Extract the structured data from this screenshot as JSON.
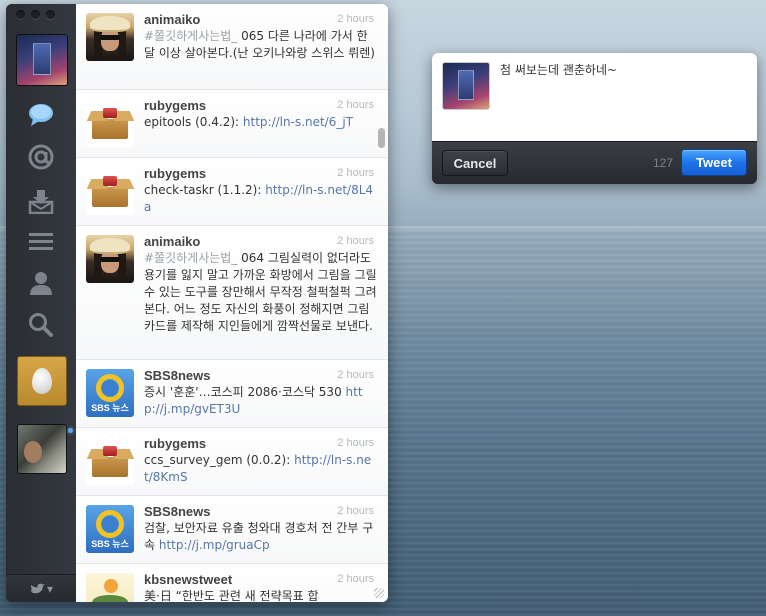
{
  "app": {
    "sidebar": {
      "nav_icons": [
        "timeline-icon",
        "mentions-icon",
        "messages-icon",
        "lists-icon",
        "profile-icon",
        "search-icon"
      ],
      "bottom_icon": "bird-icon",
      "bottom_caret": "▾"
    },
    "compose": {
      "text": "첨 써보는데 괜춘하네~",
      "cancel_label": "Cancel",
      "tweet_label": "Tweet",
      "char_count": "127"
    },
    "timeline": {
      "tweets": [
        {
          "user": "animaiko",
          "time": "2 hours",
          "hashtag": "#쫄깃하게사는법_",
          "text": " 065 다른 나라에 가서 한달 이상 살아본다.(난 오키나와랑 스위스 뤼렌)",
          "link": "",
          "avatar": "animaiko"
        },
        {
          "user": "rubygems",
          "time": "2 hours",
          "hashtag": "",
          "text": "epitools (0.4.2): ",
          "link": "http://ln-s.net/6_jT",
          "avatar": "box"
        },
        {
          "user": "rubygems",
          "time": "2 hours",
          "hashtag": "",
          "text": "check-taskr (1.1.2): ",
          "link": "http://ln-s.net/8L4a",
          "avatar": "box"
        },
        {
          "user": "animaiko",
          "time": "2 hours",
          "hashtag": "#쫄깃하게사는법_",
          "text": " 064 그림실력이 없더라도 용기를 잃지 말고 가까운 화방에서 그림을 그릴 수 있는 도구를 장만해서 무작정 철퍽철퍽 그려본다. 어느 정도 자신의 화풍이 정해지면 그림카드를 제작해 지인들에게 깜짝선물로 보낸다.",
          "link": "",
          "avatar": "animaiko"
        },
        {
          "user": "SBS8news",
          "time": "2 hours",
          "hashtag": "",
          "text": "증시 '훈훈'…코스피 2086·코스닥 530 ",
          "link": "http://j.mp/gvET3U",
          "avatar": "sbs"
        },
        {
          "user": "rubygems",
          "time": "2 hours",
          "hashtag": "",
          "text": "ccs_survey_gem (0.0.2): ",
          "link": "http://ln-s.net/8KmS",
          "avatar": "box"
        },
        {
          "user": "SBS8news",
          "time": "2 hours",
          "hashtag": "",
          "text": "검찰, 보안자료 유출 청와대 경호처 전 간부 구속 ",
          "link": "http://j.mp/gruaCp",
          "avatar": "sbs"
        },
        {
          "user": "kbsnewstweet",
          "time": "2 hours",
          "hashtag": "",
          "text": "美·日 “한반도 관련 새 전략목표 합",
          "link": "",
          "avatar": "kbs"
        }
      ],
      "sbs_label": "SBS 뉴스"
    }
  },
  "colors": {
    "link": "#5777a3",
    "tweet_button": "#1f73e8"
  }
}
